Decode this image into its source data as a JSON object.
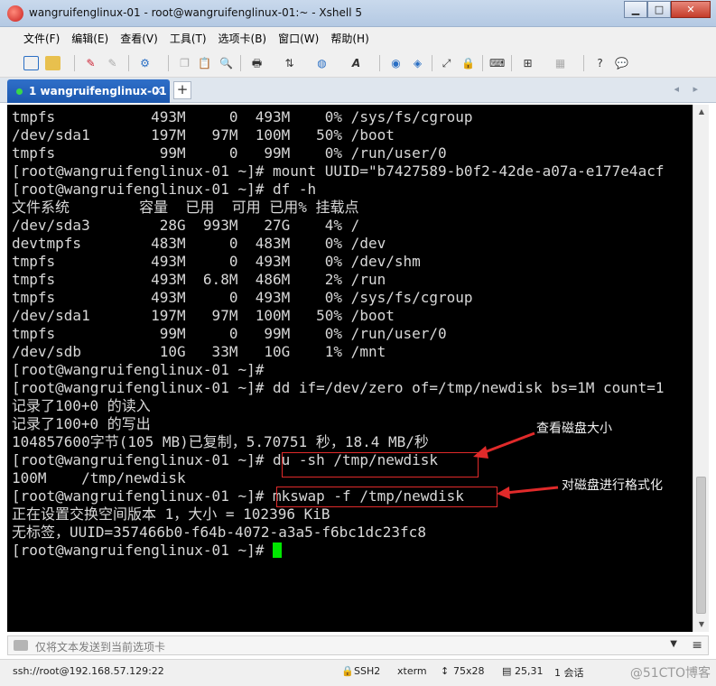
{
  "window": {
    "title": "wangruifenglinux-01 - root@wangruifenglinux-01:~ - Xshell 5",
    "minimize": "▁",
    "maximize": "□",
    "close": "✕"
  },
  "menu": [
    {
      "label": "文件(F)"
    },
    {
      "label": "编辑(E)"
    },
    {
      "label": "查看(V)"
    },
    {
      "label": "工具(T)"
    },
    {
      "label": "选项卡(B)"
    },
    {
      "label": "窗口(W)"
    },
    {
      "label": "帮助(H)"
    }
  ],
  "toolbar_icons": [
    "new-session-icon",
    "open-folder-icon",
    "connect-icon",
    "disconnect-icon",
    "session-properties-icon",
    "copy-icon",
    "paste-icon",
    "find-icon",
    "print-icon",
    "transfer-icon",
    "globe-icon",
    "font-icon",
    "xftp-icon",
    "xmanager-icon",
    "fullscreen-icon",
    "lock-icon",
    "keyboard-icon",
    "add-icon",
    "layout-icon",
    "help-icon",
    "chat-icon"
  ],
  "tab": {
    "label": "1 wangruifenglinux-01",
    "close": "×",
    "add": "+",
    "nav": "◂ ▸"
  },
  "terminal": {
    "lines": [
      "tmpfs           493M     0  493M    0% /sys/fs/cgroup",
      "/dev/sda1       197M   97M  100M   50% /boot",
      "tmpfs            99M     0   99M    0% /run/user/0",
      "[root@wangruifenglinux-01 ~]# mount UUID=\"b7427589-b0f2-42de-a07a-e177e4acf",
      "[root@wangruifenglinux-01 ~]# df -h",
      "文件系统        容量  已用  可用 已用% 挂载点",
      "/dev/sda3        28G  993M   27G    4% /",
      "devtmpfs        483M     0  483M    0% /dev",
      "tmpfs           493M     0  493M    0% /dev/shm",
      "tmpfs           493M  6.8M  486M    2% /run",
      "tmpfs           493M     0  493M    0% /sys/fs/cgroup",
      "/dev/sda1       197M   97M  100M   50% /boot",
      "tmpfs            99M     0   99M    0% /run/user/0",
      "/dev/sdb         10G   33M   10G    1% /mnt",
      "[root@wangruifenglinux-01 ~]#",
      "[root@wangruifenglinux-01 ~]# dd if=/dev/zero of=/tmp/newdisk bs=1M count=1",
      "记录了100+0 的读入",
      "记录了100+0 的写出",
      "104857600字节(105 MB)已复制，5.70751 秒，18.4 MB/秒",
      "[root@wangruifenglinux-01 ~]# du -sh /tmp/newdisk",
      "100M    /tmp/newdisk",
      "[root@wangruifenglinux-01 ~]# mkswap -f /tmp/newdisk",
      "正在设置交换空间版本 1，大小 = 102396 KiB",
      "无标签，UUID=357466b0-f64b-4072-a3a5-f6bc1dc23fc8",
      "[root@wangruifenglinux-01 ~]# "
    ],
    "annotations": [
      {
        "text": "查看磁盘大小"
      },
      {
        "text": "对磁盘进行格式化"
      }
    ]
  },
  "send_bar": {
    "placeholder": "仅将文本发送到当前选项卡"
  },
  "status": {
    "connection": "ssh://root@192.168.57.129:22",
    "protocol": "SSH2",
    "terminal_type": "xterm",
    "size": "75x28",
    "cursor_pos": "25,31",
    "sessions": "1 会话",
    "watermark": "@51CTO博客"
  },
  "colors": {
    "terminal_bg": "#000000",
    "terminal_fg": "#d8d8d8",
    "cursor": "#00e600",
    "highlight": "#e02a2a",
    "tab_active": "#1c57ad"
  }
}
